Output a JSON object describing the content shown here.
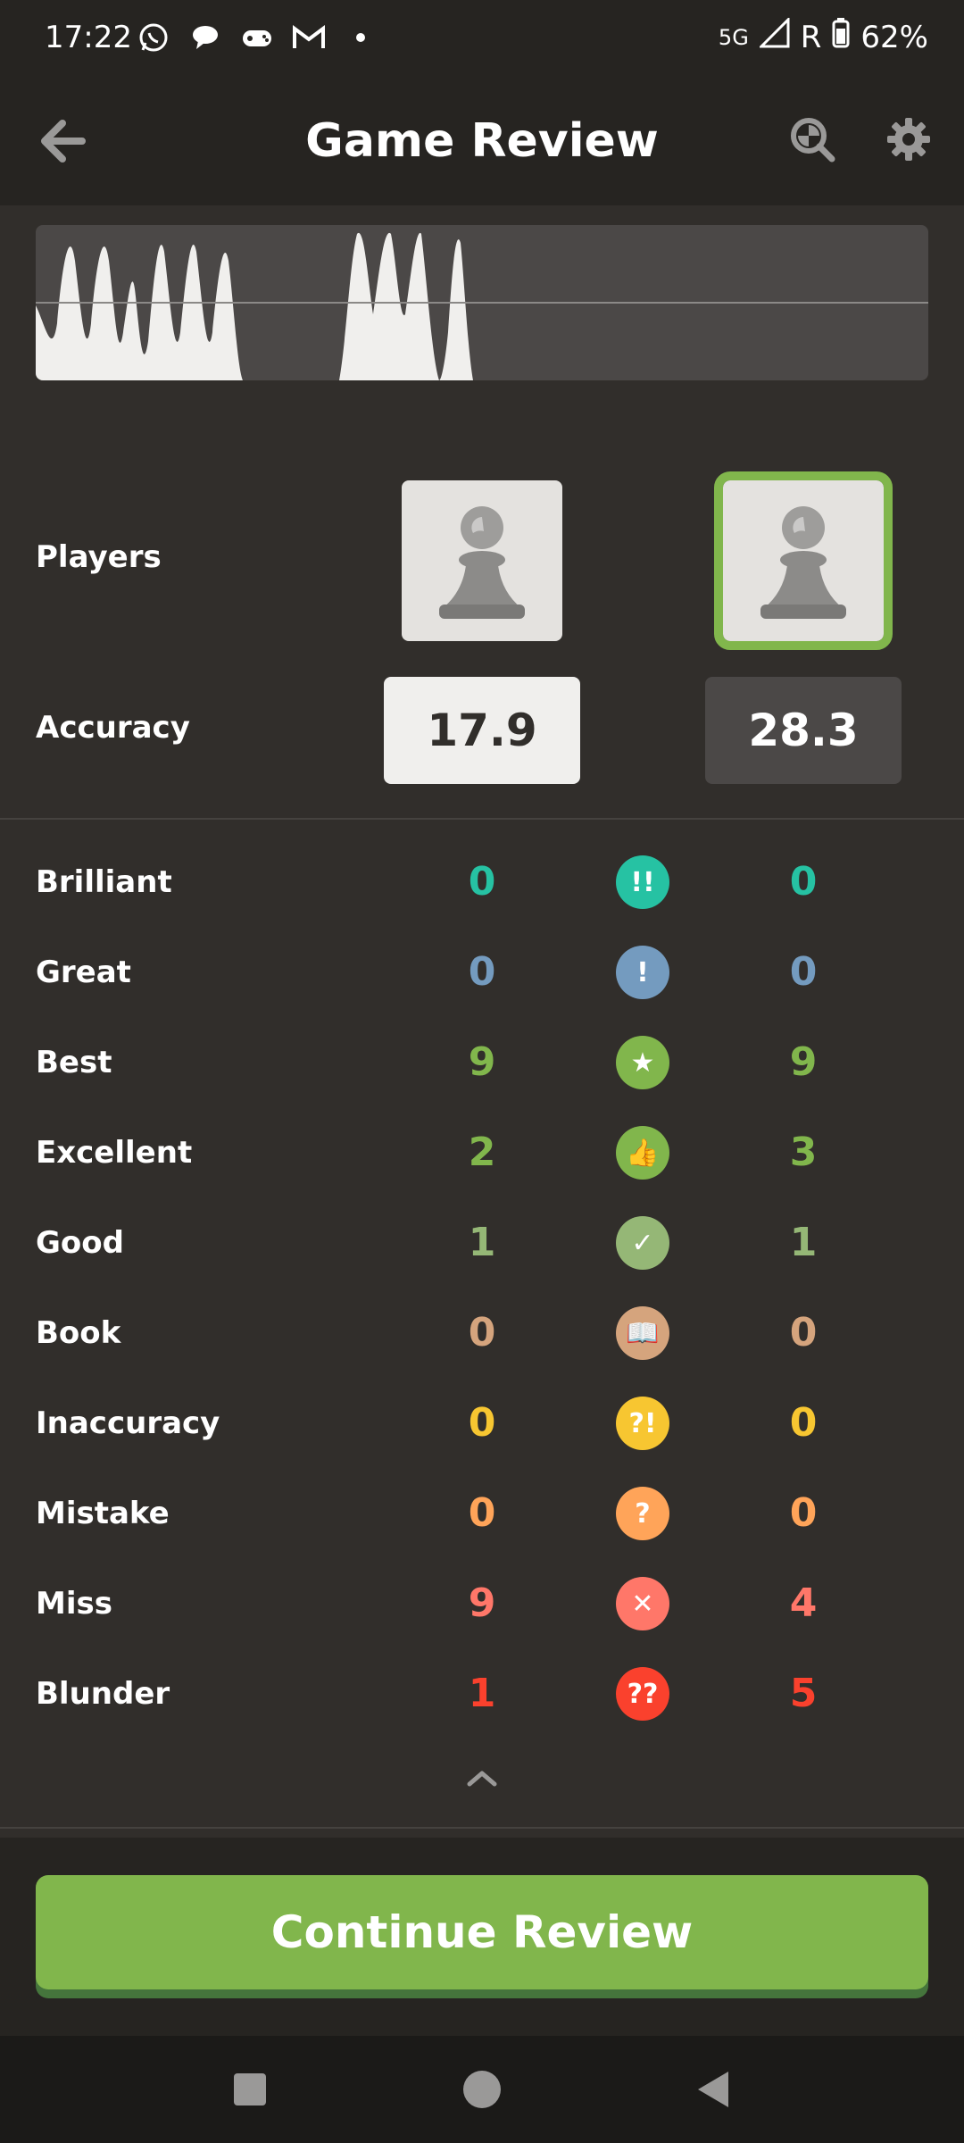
{
  "status": {
    "time": "17:22",
    "network": "5G",
    "carrier": "R",
    "battery": "62%",
    "notification_icons": [
      "whatsapp-icon",
      "chat-icon",
      "game-controller-icon",
      "gmail-icon",
      "dot-icon"
    ]
  },
  "header": {
    "title": "Game Review",
    "back_icon": "arrow-left-icon",
    "search_icon": "magnifier-icon",
    "settings_icon": "gear-icon"
  },
  "players": {
    "label": "Players",
    "white_avatar": "pawn-icon",
    "black_avatar": "pawn-icon",
    "selected": "black"
  },
  "accuracy": {
    "label": "Accuracy",
    "white": "17.9",
    "black": "28.3"
  },
  "stats": [
    {
      "label": "Brilliant",
      "white": "0",
      "black": "0",
      "symbol": "!!",
      "color": "#26c2a3",
      "icon": "brilliant-icon"
    },
    {
      "label": "Great",
      "white": "0",
      "black": "0",
      "symbol": "!",
      "color": "#749bbf",
      "icon": "great-icon"
    },
    {
      "label": "Best",
      "white": "9",
      "black": "9",
      "symbol": "★",
      "color": "#81b64c",
      "icon": "star-icon"
    },
    {
      "label": "Excellent",
      "white": "2",
      "black": "3",
      "symbol": "👍",
      "color": "#81b64c",
      "icon": "thumbs-up-icon"
    },
    {
      "label": "Good",
      "white": "1",
      "black": "1",
      "symbol": "✓",
      "color": "#95b776",
      "icon": "check-icon"
    },
    {
      "label": "Book",
      "white": "0",
      "black": "0",
      "symbol": "📖",
      "color": "#d5a47d",
      "icon": "book-icon"
    },
    {
      "label": "Inaccuracy",
      "white": "0",
      "black": "0",
      "symbol": "?!",
      "color": "#f7c631",
      "icon": "inaccuracy-icon"
    },
    {
      "label": "Mistake",
      "white": "0",
      "black": "0",
      "symbol": "?",
      "color": "#ffa459",
      "icon": "question-icon"
    },
    {
      "label": "Miss",
      "white": "9",
      "black": "4",
      "symbol": "✕",
      "color": "#ff7769",
      "icon": "x-icon"
    },
    {
      "label": "Blunder",
      "white": "1",
      "black": "5",
      "symbol": "??",
      "color": "#fa412d",
      "icon": "blunder-icon"
    }
  ],
  "cta": {
    "label": "Continue Review"
  },
  "colors": {
    "background": "#312e2b",
    "header": "#262421",
    "accent": "#81b64c"
  }
}
